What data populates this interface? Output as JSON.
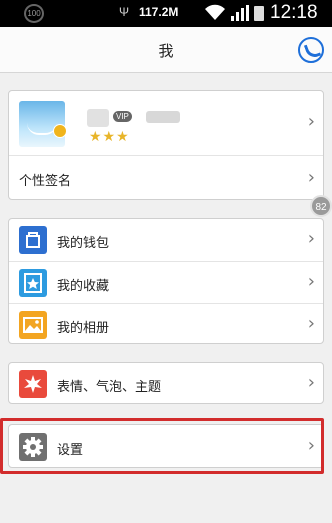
{
  "status_bar": {
    "badge": "100",
    "usb": "Ψ",
    "speed": "117.2M",
    "clock": "12:18"
  },
  "header": {
    "title": "我",
    "right_icon": "moon-icon"
  },
  "profile": {
    "vip_label": "VIP",
    "stars": "★★★",
    "signature_label": "个性签名"
  },
  "section2": {
    "items": [
      {
        "label": "我的钱包",
        "icon": "wallet-icon",
        "color": "#2d6fd0"
      },
      {
        "label": "我的收藏",
        "icon": "star-box-icon",
        "color": "#2d9be0"
      },
      {
        "label": "我的相册",
        "icon": "photo-icon",
        "color": "#f3a521"
      }
    ]
  },
  "section3": {
    "label": "表情、气泡、主题",
    "icon": "theme-icon",
    "color": "#e94a3c"
  },
  "section4": {
    "label": "设置",
    "icon": "gear-icon",
    "color": "#707070"
  },
  "side_badge": "82",
  "chevron": "›",
  "accent": "#1e6fd9",
  "highlight_color": "#d22c2c"
}
